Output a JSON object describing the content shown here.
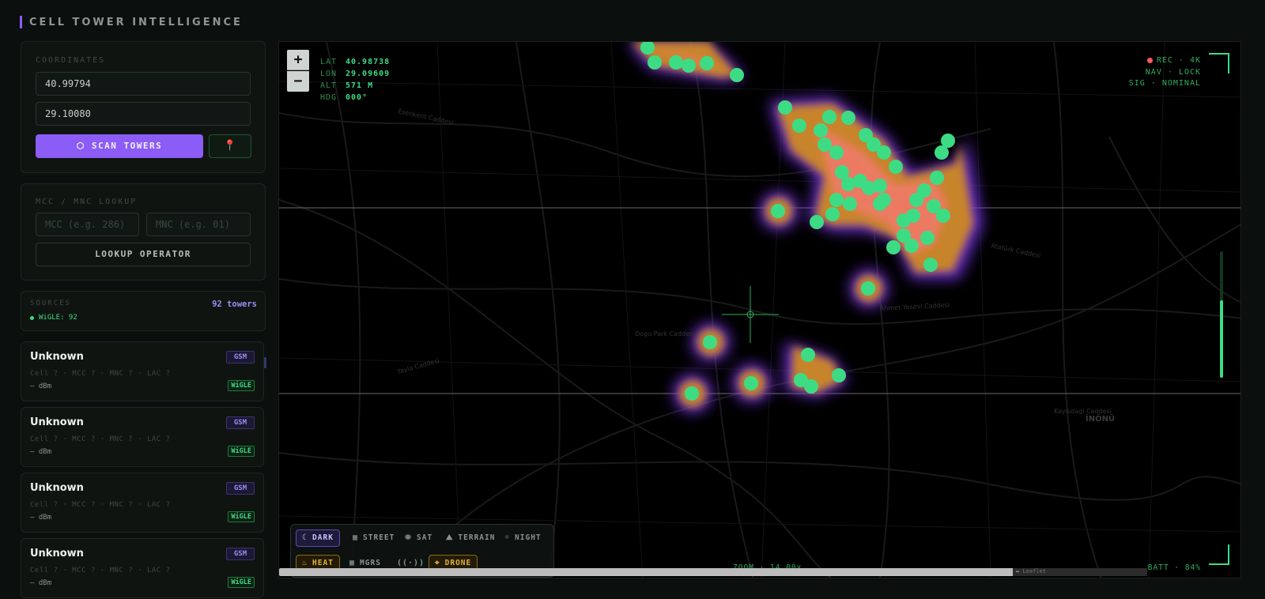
{
  "app": {
    "title": "CELL TOWER INTELLIGENCE"
  },
  "coordinates": {
    "label": "COORDINATES",
    "lat_value": "40.99794",
    "lon_value": "29.10080",
    "scan_label": "⬡ SCAN TOWERS",
    "locate_icon": "pin-icon",
    "locate_glyph": "📍"
  },
  "lookup": {
    "label": "MCC / MNC LOOKUP",
    "mcc_placeholder": "MCC (e.g. 286)",
    "mnc_placeholder": "MNC (e.g. 01)",
    "button_label": "LOOKUP OPERATOR"
  },
  "sources": {
    "label": "SOURCES",
    "count": "92 towers",
    "items": [
      {
        "label": "WiGLE: 92",
        "color": "#3ddc84"
      }
    ]
  },
  "towers": [
    {
      "name": "Unknown",
      "type": "GSM",
      "meta": "Cell ? · MCC ? · MNC ? · LAC ?",
      "signal": "— dBm",
      "source": "WiGLE"
    },
    {
      "name": "Unknown",
      "type": "GSM",
      "meta": "Cell ? · MCC ? · MNC ? · LAC ?",
      "signal": "— dBm",
      "source": "WiGLE"
    },
    {
      "name": "Unknown",
      "type": "GSM",
      "meta": "Cell ? · MCC ? · MNC ? · LAC ?",
      "signal": "— dBm",
      "source": "WiGLE"
    },
    {
      "name": "Unknown",
      "type": "GSM",
      "meta": "Cell ? · MCC ? · MNC ? · LAC ?",
      "signal": "— dBm",
      "source": "WiGLE"
    }
  ],
  "map": {
    "zoom_in": "+",
    "zoom_out": "−",
    "hud": {
      "lat_key": "LAT",
      "lat": "40.98738",
      "lon_key": "LON",
      "lon": "29.09609",
      "alt_key": "ALT",
      "alt": "571 M",
      "hdg_key": "HDG",
      "hdg": "000°"
    },
    "status": {
      "rec": "REC · 4K",
      "nav": "NAV · LOCK",
      "sig": "SIG · NOMINAL"
    },
    "zoom_readout": "ZOOM · 14.00x",
    "battery": "BATT · 84%",
    "attribution": "▬ Leaflet",
    "signal_level": 0.61,
    "street_labels": [
      "Ahmet Yesevi Caddesi",
      "Dogu Park Caddesi",
      "Kayisdagi Caddesi",
      "İNÖNÜ",
      "Yayla Caddesi",
      "Atatürk Caddesi",
      "Esenkent Caddesi"
    ],
    "base_layers": [
      {
        "label": "DARK",
        "icon": "moon-icon",
        "active": true
      },
      {
        "label": "STREET",
        "icon": "grid-icon",
        "active": false
      },
      {
        "label": "SAT",
        "icon": "satellite-icon",
        "active": false
      },
      {
        "label": "TERRAIN",
        "icon": "mountain-icon",
        "active": false
      },
      {
        "label": "NIGHT",
        "icon": "sun-icon",
        "active": false
      }
    ],
    "overlays": [
      {
        "label": "HEAT",
        "icon": "flame-icon",
        "active": true
      },
      {
        "label": "MGRS",
        "icon": "grid-icon",
        "active": false
      },
      {
        "label": "RF",
        "icon": "radio-icon",
        "active": false
      },
      {
        "label": "DRONE",
        "icon": "crosshair-icon",
        "active": true
      }
    ],
    "colors": {
      "accent": "#8b5cf6",
      "hud_green": "#3ddc84",
      "gold": "#e0b43a",
      "heat_core": "#f07a6a",
      "tower_dot": "#3ddc84"
    }
  }
}
